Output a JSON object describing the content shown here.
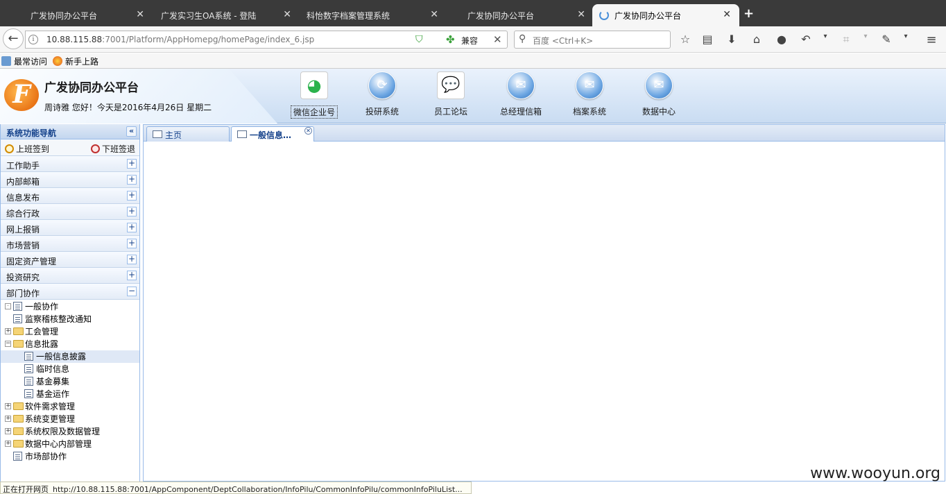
{
  "browser": {
    "tabs": [
      {
        "title": "广发协同办公平台",
        "active": false
      },
      {
        "title": "广发实习生OA系统 - 登陆",
        "active": false
      },
      {
        "title": "科怡数字档案管理系统",
        "active": false
      },
      {
        "title": "广发协同办公平台",
        "active": false
      },
      {
        "title": "广发协同办公平台",
        "active": true
      }
    ],
    "url_host": "10.88.115.88",
    "url_path": ":7001/Platform/AppHomepg/homePage/index_6.jsp",
    "compat_label": "兼容",
    "search_placeholder": "百度 <Ctrl+K>",
    "bookmarks": [
      "最常访问",
      "新手上路"
    ]
  },
  "header": {
    "logo_letter": "F",
    "title": "广发协同办公平台",
    "greeting": "周诗雅  您好！今天是2016年4月26日  星期二",
    "icons": [
      {
        "label": "微信企业号",
        "icon": "wechat-icon",
        "selected": true
      },
      {
        "label": "投研系统",
        "icon": "research-icon",
        "selected": false
      },
      {
        "label": "员工论坛",
        "icon": "forum-icon",
        "selected": false
      },
      {
        "label": "总经理信箱",
        "icon": "mailbox-icon",
        "selected": false
      },
      {
        "label": "档案系统",
        "icon": "archive-icon",
        "selected": false
      },
      {
        "label": "数据中心",
        "icon": "datacenter-icon",
        "selected": false
      }
    ]
  },
  "sidebar": {
    "title": "系统功能导航",
    "checkin": "上班签到",
    "checkout": "下班签退",
    "sections": [
      "工作助手",
      "内部邮箱",
      "信息发布",
      "综合行政",
      "网上报销",
      "市场营销",
      "固定资产管理",
      "投资研究",
      "部门协作"
    ],
    "tree": [
      {
        "label": "一般协作",
        "type": "doc",
        "depth": 0,
        "expander": "dot"
      },
      {
        "label": "监察稽核整改通知",
        "type": "doc",
        "depth": 0,
        "expander": ""
      },
      {
        "label": "工会管理",
        "type": "folder",
        "depth": 0,
        "expander": "+"
      },
      {
        "label": "信息批露",
        "type": "folder",
        "depth": 0,
        "expander": "-"
      },
      {
        "label": "一般信息披露",
        "type": "doc",
        "depth": 1,
        "expander": "",
        "selected": true
      },
      {
        "label": "临时信息",
        "type": "doc",
        "depth": 1,
        "expander": ""
      },
      {
        "label": "基金募集",
        "type": "doc",
        "depth": 1,
        "expander": ""
      },
      {
        "label": "基金运作",
        "type": "doc",
        "depth": 1,
        "expander": ""
      },
      {
        "label": "软件需求管理",
        "type": "folder",
        "depth": 0,
        "expander": "+"
      },
      {
        "label": "系统变更管理",
        "type": "folder",
        "depth": 0,
        "expander": "+"
      },
      {
        "label": "系统权限及数据管理",
        "type": "folder",
        "depth": 0,
        "expander": "+"
      },
      {
        "label": "数据中心内部管理",
        "type": "folder",
        "depth": 0,
        "expander": "+"
      },
      {
        "label": "市场部协作",
        "type": "doc",
        "depth": 0,
        "expander": ""
      }
    ]
  },
  "main": {
    "tabs": [
      {
        "label": "主页",
        "active": false,
        "closable": false
      },
      {
        "label": "一般信息…",
        "active": true,
        "closable": true
      }
    ]
  },
  "status": {
    "text": "正在打开网页",
    "url": "http://10.88.115.88:7001/AppComponent/DeptCollaboration/InfoPilu/CommonInfoPilu/commonInfoPiluList..."
  },
  "watermark": "www.wooyun.org"
}
